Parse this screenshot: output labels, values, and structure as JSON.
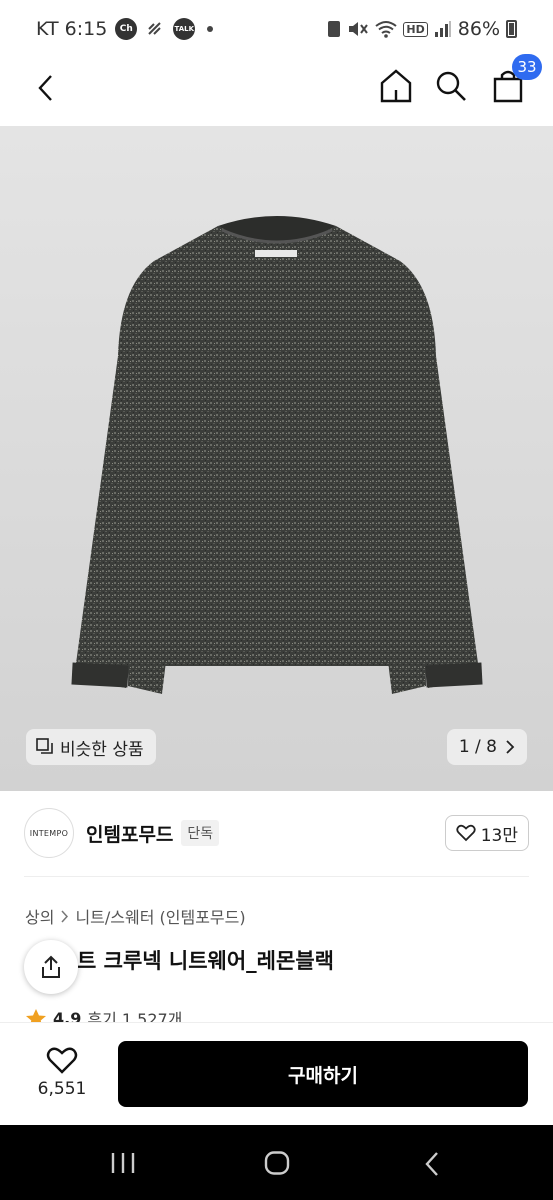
{
  "status_bar": {
    "carrier_time": "KT 6:15",
    "notif_ch": "Ch",
    "notif_talk": "TALK",
    "hd": "HD",
    "battery": "86%"
  },
  "app_bar": {
    "cart_count": "33"
  },
  "hero": {
    "similar_label": "비슷한 상품",
    "pager": "1 / 8"
  },
  "brand": {
    "logo_text": "INTEMPO",
    "name": "인템포무드",
    "exclusive": "단독",
    "likes": "13만"
  },
  "breadcrumb": {
    "level1": "상의",
    "level2": "니트/스웨터 (인템포무드)"
  },
  "product": {
    "title": "트 크루넥 니트웨어_레몬블랙"
  },
  "rating": {
    "score": "4.9",
    "reviews": "후기 1,527개"
  },
  "bottom_bar": {
    "wish_count": "6,551",
    "buy_label": "구매하기"
  },
  "colors": {
    "accent": "#2f6bf0",
    "star": "#f0a020",
    "buy_button": "#000000"
  }
}
